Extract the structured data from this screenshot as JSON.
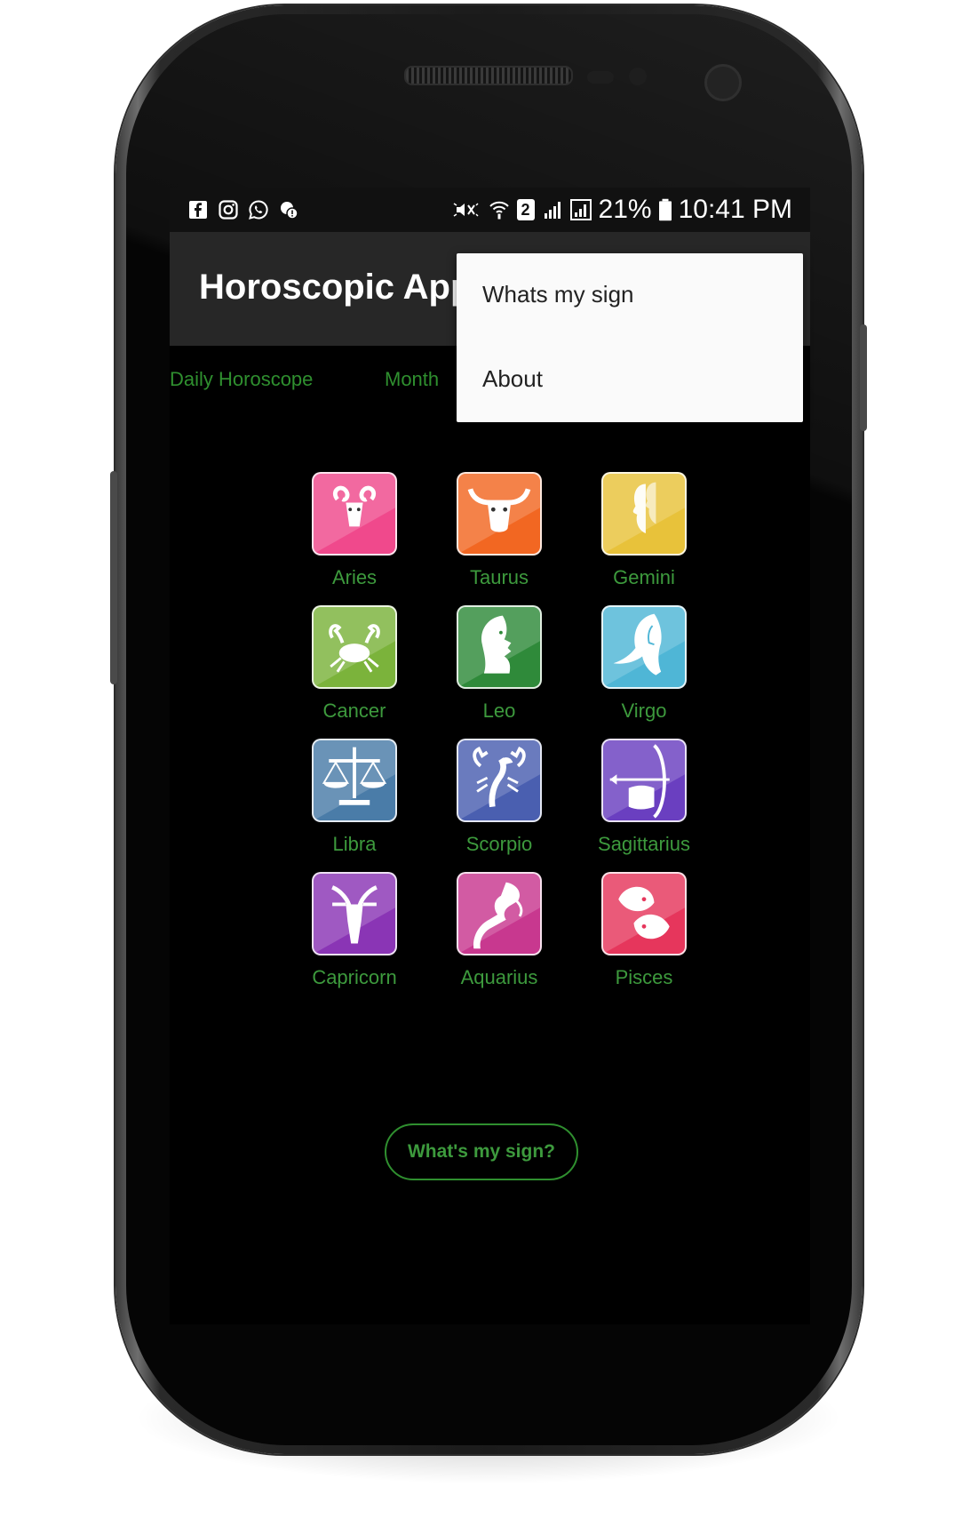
{
  "status_bar": {
    "battery": "21%",
    "time": "10:41 PM",
    "sim_label": "2",
    "left_icons": [
      "facebook-icon",
      "instagram-icon",
      "whatsapp-icon",
      "notification-icon"
    ],
    "right_icons": [
      "mute-icon",
      "wifi-icon",
      "sim-2-icon",
      "signal-icon",
      "signal-icon-2",
      "battery-icon"
    ]
  },
  "app_bar": {
    "title": "Horoscopic App"
  },
  "tabs": [
    {
      "label": "Daily Horoscope"
    },
    {
      "label": "Month"
    }
  ],
  "menu": {
    "items": [
      {
        "label": "Whats my sign"
      },
      {
        "label": "About"
      }
    ]
  },
  "signs": [
    {
      "name": "Aries",
      "color": "#f0498c",
      "icon": "ram-icon"
    },
    {
      "name": "Taurus",
      "color": "#f26722",
      "icon": "bull-icon"
    },
    {
      "name": "Gemini",
      "color": "#e8c23a",
      "icon": "twins-icon"
    },
    {
      "name": "Cancer",
      "color": "#7bb33b",
      "icon": "crab-icon"
    },
    {
      "name": "Leo",
      "color": "#2f8a3a",
      "icon": "lion-icon"
    },
    {
      "name": "Virgo",
      "color": "#4fb6d6",
      "icon": "maiden-icon"
    },
    {
      "name": "Libra",
      "color": "#4a7ca8",
      "icon": "scales-icon"
    },
    {
      "name": "Scorpio",
      "color": "#4a5fb0",
      "icon": "scorpion-icon"
    },
    {
      "name": "Sagittarius",
      "color": "#6a3fc0",
      "icon": "archer-icon"
    },
    {
      "name": "Capricorn",
      "color": "#8a35b5",
      "icon": "goat-icon"
    },
    {
      "name": "Aquarius",
      "color": "#c8388f",
      "icon": "water-bearer-icon"
    },
    {
      "name": "Pisces",
      "color": "#e6365c",
      "icon": "fish-icon"
    }
  ],
  "action_button": {
    "label": "What's my sign?"
  },
  "colors": {
    "screen_bg": "#000000",
    "app_bar_bg": "#272727",
    "accent_green": "#2f8f2f",
    "menu_bg": "#fafafa"
  }
}
